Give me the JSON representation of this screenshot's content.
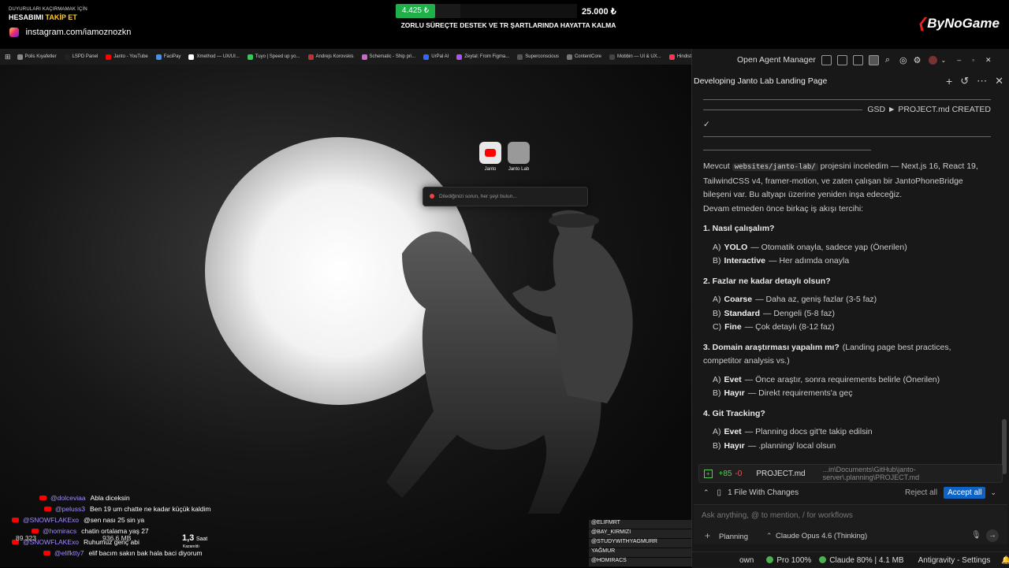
{
  "overlay": {
    "promo_line1": "DUYURULARI KAÇIRMAMAK İÇİN",
    "promo_line2_prefix": "HESABIMI",
    "promo_line2_emph": "TAKİP ET",
    "instagram_handle": "instagram.com/iamoznozkn",
    "donation_current": "4.425 ₺",
    "donation_goal": "25.000 ₺",
    "donation_progress": 0.177,
    "goal_text": "ZORLU SÜREÇTE DESTEK VE TR ŞARTLARINDA HAYATTA KALMA",
    "brand_prefix": "By",
    "brand_name": "NoGame"
  },
  "bookmarks": [
    {
      "label": "Polis Kıyafetler",
      "color": "#888888"
    },
    {
      "label": "LSPD Panel",
      "color": "#222222"
    },
    {
      "label": "Janto - YouTube",
      "color": "#ff0000"
    },
    {
      "label": "FaciPay",
      "color": "#4a90e2"
    },
    {
      "label": "Xmethod — UX/UI...",
      "color": "#ffffff"
    },
    {
      "label": "Tuyo | Speed up yo...",
      "color": "#34c759"
    },
    {
      "label": "Andrejs Korovskis",
      "color": "#bb3333"
    },
    {
      "label": "Schematic - Ship pri...",
      "color": "#cc66cc"
    },
    {
      "label": "UrPal AI",
      "color": "#3366ff"
    },
    {
      "label": "Zeytal: From Figma...",
      "color": "#a855f7"
    },
    {
      "label": "Superconscious",
      "color": "#555555"
    },
    {
      "label": "ContentCore",
      "color": "#777777"
    },
    {
      "label": "Mobbin — UI & UX...",
      "color": "#444444"
    },
    {
      "label": "Hindistan",
      "color": "#ff3355"
    }
  ],
  "newtab": {
    "shortcuts": [
      {
        "label": "Janto"
      },
      {
        "label": "Janto Lab"
      }
    ],
    "search_placeholder": "Dilediğinizi sorun, her şeyi bulun..."
  },
  "chat": [
    {
      "user": "@dolceviaa",
      "msg": "Abla diceksin"
    },
    {
      "user": "@peluss3",
      "msg": "Ben 19 um chatte ne kadar küçük kaldim"
    },
    {
      "user": "@SNOWFLAKExo",
      "msg": "@sen nası 25 sin ya"
    },
    {
      "user": "@homiracs",
      "msg": "chatin ortalama yaş 27"
    },
    {
      "user": "@SNOWFLAKExo",
      "msg": "Ruhumuz genç abi"
    },
    {
      "user": "@elifktty7",
      "msg": "elif bacım sakın bak hala baci diyorum"
    }
  ],
  "stats": {
    "value1": "89.323",
    "value2": "936.6 MB",
    "hours": "1,3",
    "hours_unit": "Saat",
    "hours_caption": "Kazanıldı"
  },
  "viewers": [
    {
      "name": "@ELIFMRT",
      "tag": "MEMBER"
    },
    {
      "name": "@BAY_KIRMIZI",
      "tag": "MEMBER"
    },
    {
      "name": "@STUDYWITHYAGMURR",
      "tag": "GIFTED X1"
    },
    {
      "name": "YAĞMUR",
      "tag": "TRY 10,00"
    },
    {
      "name": "@HOMIRACS",
      "tag": "MEMBER"
    }
  ],
  "ide": {
    "window_title": "Open Agent Manager",
    "conversation_title": "Developing Janto Lab Landing Page",
    "banner": "GSD ► PROJECT.md CREATED",
    "checkmark": "✓",
    "intro_prefix": "Mevcut",
    "intro_code": "websites/janto-lab/",
    "intro_text": "projesini inceledim — Next.js 16, React 19, TailwindCSS v4, framer-motion, ve zaten çalışan bir JantoPhoneBridge bileşeni var. Bu altyapı üzerine yeniden inşa edeceğiz.",
    "prompt": "Devam etmeden önce birkaç iş akışı tercihi:",
    "questions": [
      {
        "title": "1. Nasıl çalışalım?",
        "note": "",
        "options": [
          {
            "prefix": "A)",
            "key": "YOLO",
            "text": "— Otomatik onayla, sadece yap (Önerilen)"
          },
          {
            "prefix": "B)",
            "key": "Interactive",
            "text": "— Her adımda onayla"
          }
        ]
      },
      {
        "title": "2. Fazlar ne kadar detaylı olsun?",
        "note": "",
        "options": [
          {
            "prefix": "A)",
            "key": "Coarse",
            "text": "— Daha az, geniş fazlar (3-5 faz)"
          },
          {
            "prefix": "B)",
            "key": "Standard",
            "text": "— Dengeli (5-8 faz)"
          },
          {
            "prefix": "C)",
            "key": "Fine",
            "text": "— Çok detaylı (8-12 faz)"
          }
        ]
      },
      {
        "title": "3. Domain araştırması yapalım mı?",
        "note": "(Landing page best practices, competitor analysis vs.)",
        "options": [
          {
            "prefix": "A)",
            "key": "Evet",
            "text": "— Önce araştır, sonra requirements belirle (Önerilen)"
          },
          {
            "prefix": "B)",
            "key": "Hayır",
            "text": "— Direkt requirements'a geç"
          }
        ]
      },
      {
        "title": "4. Git Tracking?",
        "note": "",
        "options": [
          {
            "prefix": "A)",
            "key": "Evet",
            "text": "— Planning docs git'te takip edilsin"
          },
          {
            "prefix": "B)",
            "key": "Hayır",
            "text": "— .planning/ local olsun"
          }
        ]
      }
    ],
    "file_change": {
      "added": "+85",
      "removed": "-0",
      "name": "PROJECT.md",
      "path": "...in\\Documents\\GitHub\\janto-server\\.planning\\PROJECT.md"
    },
    "files_summary": "1 File With Changes",
    "reject_all": "Reject all",
    "accept_all": "Accept all",
    "input_placeholder": "Ask anything, @ to mention, / for workflows",
    "mode_label": "Planning",
    "model_label": "Claude Opus 4.6 (Thinking)",
    "status": {
      "left": "own",
      "pro": "Pro 100%",
      "claude": "Claude 80% | 4.1 MB",
      "settings": "Antigravity - Settings"
    }
  }
}
